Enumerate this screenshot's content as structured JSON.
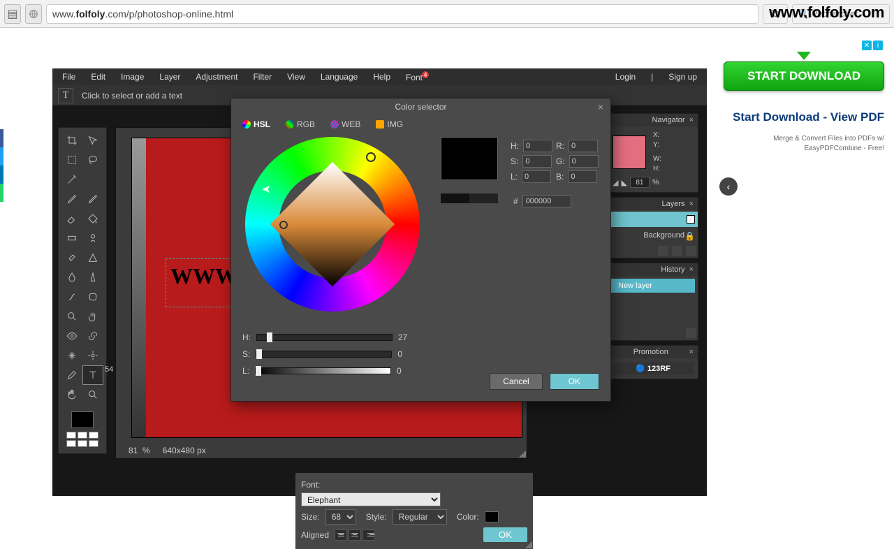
{
  "browser": {
    "url_prefix": "www.",
    "url_bold": "folfoly",
    "url_suffix": ".com/p/photoshop-online.html",
    "search_placeholder": "Rechercher",
    "watermark": "www.folfoly.com"
  },
  "menubar": {
    "items": [
      "File",
      "Edit",
      "Image",
      "Layer",
      "Adjustment",
      "Filter",
      "View",
      "Language",
      "Help",
      "Font"
    ],
    "font_badge": "4",
    "login": "Login",
    "signup": "Sign up"
  },
  "options_bar": {
    "hint": "Click to select or add a text"
  },
  "toolbox": {
    "label": "54"
  },
  "canvas": {
    "text_sample": "WWW",
    "zoom": "81",
    "zoom_unit": "%",
    "dims": "640x480 px"
  },
  "text_dialog": {
    "font_label": "Font:",
    "font_value": "Elephant",
    "size_label": "Size:",
    "size_value": "68",
    "style_label": "Style:",
    "style_value": "Regular",
    "color_label": "Color:",
    "aligned_label": "Aligned",
    "ok": "OK"
  },
  "panels": {
    "navigator": {
      "title": "Navigator",
      "x": "X:",
      "y": "Y:",
      "w": "W:",
      "h": "H:",
      "zoom": "81",
      "unit": "%"
    },
    "layers": {
      "title": "Layers",
      "background": "Background"
    },
    "history": {
      "title": "History",
      "item": "New layer"
    },
    "promotion": {
      "title": "Promotion",
      "logo": "123RF"
    }
  },
  "color_dialog": {
    "title": "Color selector",
    "tabs": {
      "hsl": "HSL",
      "rgb": "RGB",
      "web": "WEB",
      "img": "IMG"
    },
    "labels": {
      "H": "H:",
      "S": "S:",
      "L": "L:",
      "R": "R:",
      "G": "G:",
      "B": "B:",
      "hex": "#"
    },
    "values": {
      "H": "0",
      "S": "0",
      "L": "0",
      "R": "0",
      "G": "0",
      "B": "0",
      "hex": "000000"
    },
    "sliders": {
      "H_label": "H:",
      "H_val": "27",
      "S_label": "S:",
      "S_val": "0",
      "L_label": "L:",
      "L_val": "0"
    },
    "cancel": "Cancel",
    "ok": "OK"
  },
  "ad": {
    "button": "START DOWNLOAD",
    "headline": "Start Download - View PDF",
    "sub": "Merge & Convert Files into PDFs w/ EasyPDFCombine - Free!"
  }
}
